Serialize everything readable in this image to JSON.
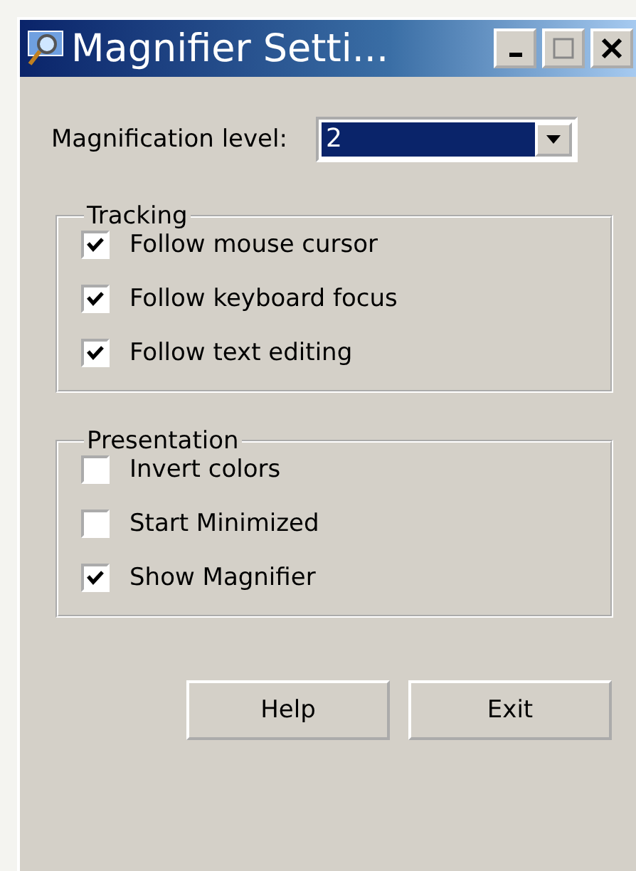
{
  "window": {
    "title": "Magnifier Setti..."
  },
  "magnification": {
    "label": "Magnification level:",
    "value": "2"
  },
  "groups": [
    {
      "title": "Tracking",
      "options": [
        {
          "label": "Follow mouse cursor",
          "checked": true
        },
        {
          "label": "Follow keyboard focus",
          "checked": true
        },
        {
          "label": "Follow text editing",
          "checked": true
        }
      ]
    },
    {
      "title": "Presentation",
      "options": [
        {
          "label": "Invert colors",
          "checked": false
        },
        {
          "label": "Start Minimized",
          "checked": false
        },
        {
          "label": "Show Magnifier",
          "checked": true
        }
      ]
    }
  ],
  "buttons": [
    {
      "label": "Help"
    },
    {
      "label": "Exit"
    }
  ]
}
